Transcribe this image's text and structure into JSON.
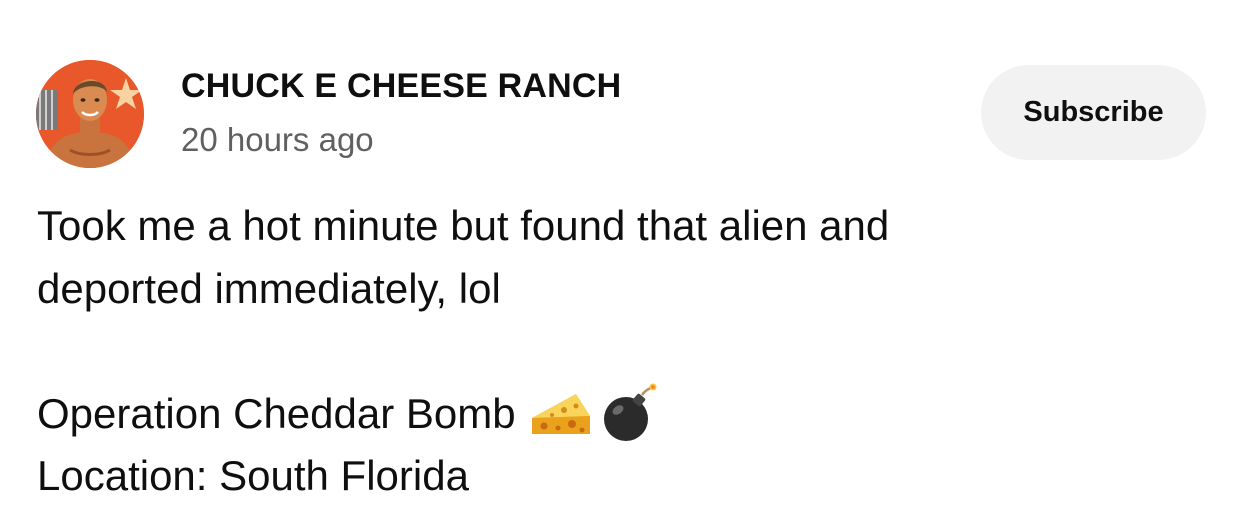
{
  "channel": {
    "name": "CHUCK E CHEESE RANCH",
    "timestamp": "20 hours ago",
    "avatar_icon": "person-avatar"
  },
  "actions": {
    "subscribe_label": "Subscribe"
  },
  "post": {
    "line1": "Took me a hot minute but found that alien and",
    "line2": "deported immediately, lol",
    "line3": "Operation Cheddar Bomb",
    "line4": "Location: South Florida",
    "emojis": [
      "cheese-icon",
      "bomb-icon"
    ]
  },
  "colors": {
    "text_primary": "#0f0f0f",
    "text_secondary": "#606060",
    "button_bg": "#f2f2f2",
    "avatar_bg": "#e8582b"
  }
}
